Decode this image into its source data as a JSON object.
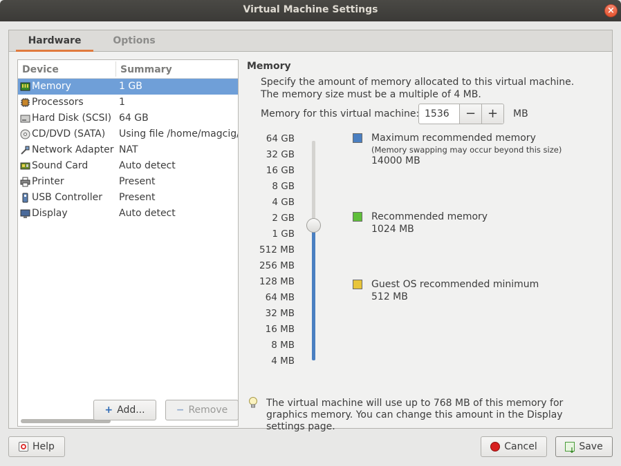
{
  "window": {
    "title": "Virtual Machine Settings",
    "close_glyph": "×"
  },
  "tabs": [
    {
      "label": "Hardware",
      "active": true
    },
    {
      "label": "Options",
      "active": false
    }
  ],
  "device_list": {
    "columns": [
      "Device",
      "Summary"
    ],
    "rows": [
      {
        "icon": "memory-icon",
        "name": "Memory",
        "summary": "1 GB",
        "selected": true
      },
      {
        "icon": "processor-icon",
        "name": "Processors",
        "summary": "1"
      },
      {
        "icon": "hard-disk-icon",
        "name": "Hard Disk (SCSI)",
        "summary": "64 GB"
      },
      {
        "icon": "cd-dvd-icon",
        "name": "CD/DVD (SATA)",
        "summary": "Using file /home/magcig/Do"
      },
      {
        "icon": "network-adapter-icon",
        "name": "Network Adapter",
        "summary": "NAT"
      },
      {
        "icon": "sound-card-icon",
        "name": "Sound Card",
        "summary": "Auto detect"
      },
      {
        "icon": "printer-icon",
        "name": "Printer",
        "summary": "Present"
      },
      {
        "icon": "usb-controller-icon",
        "name": "USB Controller",
        "summary": "Present"
      },
      {
        "icon": "display-icon",
        "name": "Display",
        "summary": "Auto detect"
      }
    ]
  },
  "device_buttons": {
    "add": "Add...",
    "remove": "Remove"
  },
  "memory": {
    "section_title": "Memory",
    "description": "Specify the amount of memory allocated to this virtual machine. The memory size must be a multiple of 4 MB.",
    "field_label": "Memory for this virtual machine:",
    "value": "1536",
    "minus": "−",
    "plus": "+",
    "unit": "MB",
    "scale": [
      "64 GB",
      "32 GB",
      "16 GB",
      "8 GB",
      "4 GB",
      "2 GB",
      "1 GB",
      "512 MB",
      "256 MB",
      "128 MB",
      "64 MB",
      "32 MB",
      "16 MB",
      "8 MB",
      "4 MB"
    ],
    "slider_value_mb": 1536,
    "legend": [
      {
        "color": "#4a7fc1",
        "title": "Maximum recommended memory",
        "note": "(Memory swapping may occur beyond this size)",
        "value": "14000 MB"
      },
      {
        "color": "#5fbf3a",
        "title": "Recommended memory",
        "value": "1024 MB"
      },
      {
        "color": "#e8c53a",
        "title": "Guest OS recommended minimum",
        "value": "512 MB"
      }
    ],
    "info": "The virtual machine will use up to 768 MB of this memory for graphics memory. You can change this amount in the Display settings page."
  },
  "footer": {
    "help": "Help",
    "cancel": "Cancel",
    "save": "Save"
  },
  "colors": {
    "selection": "#6f9fd8",
    "tab_accent": "#e07a3d",
    "titlebar": "#3b3a37"
  }
}
